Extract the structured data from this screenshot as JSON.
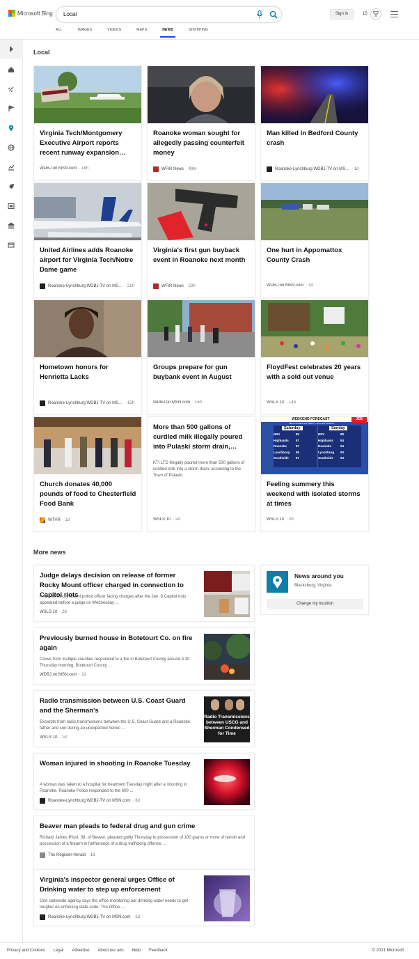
{
  "header": {
    "brand": "Microsoft Bing",
    "search_query": "Local",
    "signin_label": "Sign in",
    "points": "15",
    "scopes": [
      "ALL",
      "IMAGES",
      "VIDEOS",
      "MAPS",
      "NEWS",
      "SHOPPING"
    ],
    "active_scope": "NEWS"
  },
  "rail": {
    "icons": [
      "chevron-right-icon",
      "home-icon",
      "satellite-icon",
      "flag-icon",
      "location-icon",
      "globe-icon",
      "chart-icon",
      "rocket-icon",
      "film-icon",
      "bank-icon",
      "card-icon"
    ]
  },
  "local": {
    "title": "Local",
    "cards": [
      {
        "title": "Virginia Tech/Montgomery Executive Airport reports recent runway expansion…",
        "source": "WDBJ on MSN.com",
        "age": "· 18h",
        "favicon": "wdbj"
      },
      {
        "title": "Roanoke woman sought for allegedly passing counterfeit money",
        "source": "WFIR News",
        "age": "· 49m",
        "favicon": "wfir"
      },
      {
        "title": "Man killed in Bedford County crash",
        "source": "Roanoke-Lynchburg WDBJ-TV on MS…",
        "age": "· 1d",
        "favicon": "wdbjtv"
      },
      {
        "title": "United Airlines adds Roanoke airport for Virginia Tech/Notre Dame game",
        "source": "Roanoke-Lynchburg WDBJ-TV on MS…",
        "age": "· 21h",
        "favicon": "wdbjtv"
      },
      {
        "title": "Virginia's first gun buyback event in Roanoke next month",
        "source": "WFIR News",
        "age": "· 22h",
        "favicon": "wfir"
      },
      {
        "title": "One hurt in Appomattox County Crash",
        "source": "WDBJ on MSN.com",
        "age": "· 1d",
        "favicon": "wdbj"
      },
      {
        "title": "Hometown honors for Henrietta Lacks",
        "source": "Roanoke-Lynchburg WDBJ-TV on MS…",
        "age": "· 15h",
        "favicon": "wdbjtv"
      },
      {
        "title": "Groups prepare for gun buybank event in August",
        "source": "WDBJ on MSN.com",
        "age": "· 16h",
        "favicon": "wdbj"
      },
      {
        "title": "FloydFest celebrates 20 years with a sold out venue",
        "source": "WSLS 10",
        "age": "· 14h",
        "favicon": "wsls"
      },
      {
        "title": "Church donates 40,000 pounds of food to Chesterfield Food Bank",
        "source": "WTVR",
        "age": "· 1d",
        "favicon": "wtvr"
      },
      {
        "title": "More than 500 gallons of curdled milk illegally poured into Pulaski storm drain,…",
        "snippet": "KTI LTD illegally poured more than 500 gallons of curdled milk into a storm drain, according to the Town of Pulaski.",
        "source": "WSLS 10",
        "age": "· 2d",
        "favicon": "wsls"
      },
      {
        "title": "Feeling summery this weekend with isolated storms at times",
        "source": "WSLS 10",
        "age": "· 2h",
        "favicon": "wsls"
      }
    ]
  },
  "weather_graphic": {
    "banner": "WEEKEND FORECAST",
    "subbanner": "FEW STORMS SATURDAY • HOTTER SUNDAY",
    "brand": "JEB",
    "day1": "Saturday",
    "day2": "Sunday",
    "rows": [
      {
        "city": "NRV",
        "sat": "85",
        "sun": "88"
      },
      {
        "city": "Highlands",
        "sat": "87",
        "sun": "94"
      },
      {
        "city": "Roanoke",
        "sat": "87",
        "sun": "94"
      },
      {
        "city": "Lynchburg",
        "sat": "85",
        "sun": "93"
      },
      {
        "city": "Southside",
        "sat": "87",
        "sun": "94"
      }
    ]
  },
  "more_news": {
    "title": "More news",
    "items": [
      {
        "title": "Judge delays decision on release of former Rocky Mount officer charged in connection to Capitol riots",
        "snippet": "A former Rocky Mount police officer facing charges after the Jan. 6 Capitol riots appeared before a judge on Wednesday ...",
        "source": "WSLS 10",
        "age": "· 2d",
        "favicon": "none"
      },
      {
        "title": "Previously burned house in Botetourt Co. on fire again",
        "snippet": "Crews from multiple counties responded to a fire in Botetourt County around 4:30 Thursday morning. Botetourt County ...",
        "source": "WDBJ on MSN.com",
        "age": "· 2d",
        "favicon": "none"
      },
      {
        "title": "Radio transmission between U.S. Coast Guard and the Sherman's",
        "snippet": "Excerpts from radio transmissions between the U.S. Coast Guard and a Roanoke father and son during an unexpected heroic ...",
        "source": "WSLS 10",
        "age": "· 1d",
        "favicon": "none"
      },
      {
        "title": "Woman injured in shooting in Roanoke Tuesday",
        "snippet": "A woman was taken to a hospital for treatment Tuesday night after a shooting in Roanoke. Roanoke Police responded to the 600 ...",
        "source": "Roanoke-Lynchburg WDBJ-TV on MSN.com",
        "age": "· 3d",
        "favicon": "wdbjtv"
      },
      {
        "title": "Beaver man pleads to federal drug and gun crime",
        "snippet": "Richard James Pfost, 38, of Beaver, pleaded guilty Thursday to possession of 100 grams or more of heroin and possession of a firearm in furtherance of a drug trafficking offense, ...",
        "source": "The Register-Herald",
        "age": "· 1d",
        "favicon": "register"
      },
      {
        "title": "Virginia's inspector general urges Office of Drinking water to step up enforcement",
        "snippet": "One statewide agency says the office monitoring our drinking water needs to get tougher on enforcing state code. The Office ...",
        "source": "Roanoke-Lynchburg WDBJ-TV on MSN.com",
        "age": "· 1d",
        "favicon": "wdbjtv"
      }
    ],
    "radio_thumb_text": "Radio Transmissions between USCG and Sherman Condensed for Time"
  },
  "around": {
    "title": "News around you",
    "location": "Blacksburg, Virginia",
    "button": "Change my location"
  },
  "footer": {
    "links": [
      "Privacy and Cookies",
      "Legal",
      "Advertise",
      "About our ads",
      "Help",
      "Feedback"
    ],
    "copyright": "© 2021 Microsoft"
  },
  "colors": {
    "accent": "#174ae4",
    "pin": "#0f7ea6",
    "bing_blue": "#0078d4"
  }
}
